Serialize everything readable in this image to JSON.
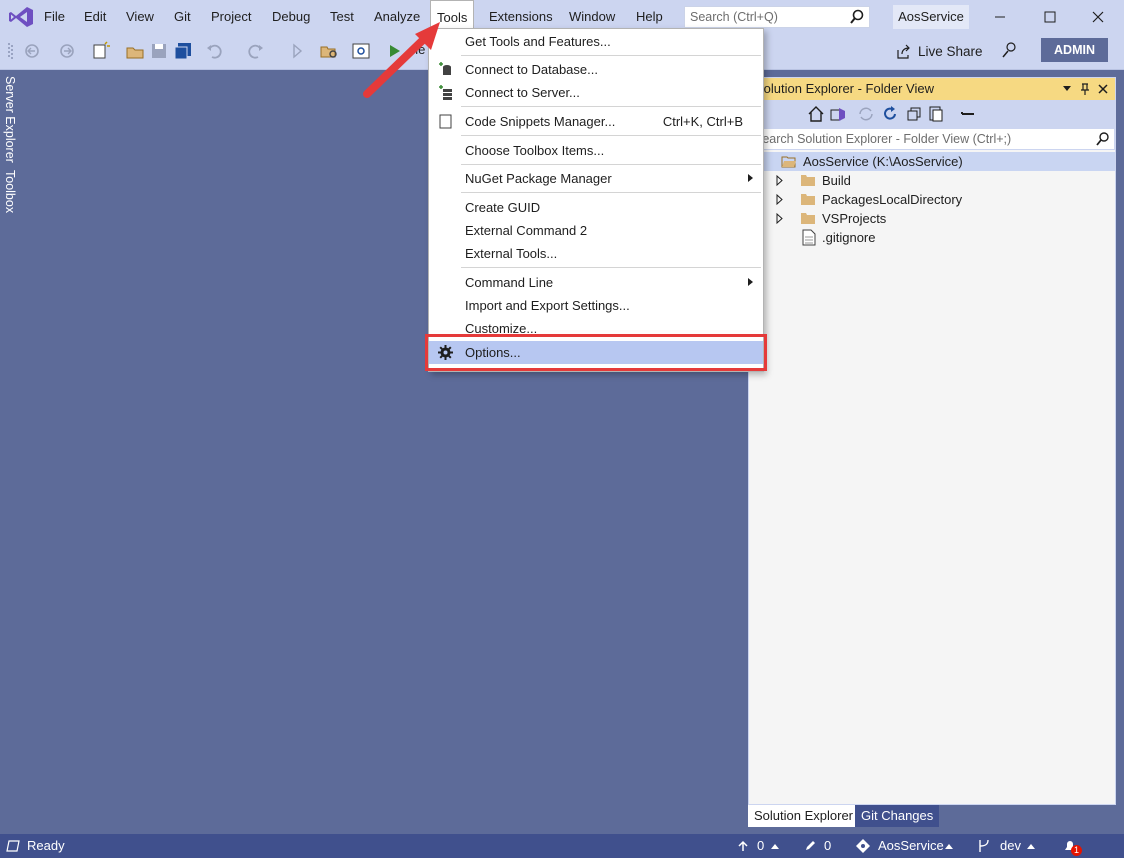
{
  "menubar": {
    "items": [
      "File",
      "Edit",
      "View",
      "Git",
      "Project",
      "Debug",
      "Test",
      "Analyze",
      "Tools",
      "Extensions",
      "Window",
      "Help"
    ],
    "search_placeholder": "Search (Ctrl+Q)",
    "project_name": "AosService"
  },
  "toolbar": {
    "live_share_label": "Live Share",
    "admin_label": "ADMIN",
    "start_label_partial": "ele"
  },
  "sidebar": {
    "tabs": [
      "Server Explorer",
      "Toolbox"
    ]
  },
  "tools_menu": {
    "items": [
      {
        "label": "Get Tools and Features...",
        "icon": ""
      },
      {
        "label": "Connect to Database...",
        "icon": "database-connect-icon"
      },
      {
        "label": "Connect to Server...",
        "icon": "server-connect-icon"
      },
      {
        "label": "Code Snippets Manager...",
        "shortcut": "Ctrl+K, Ctrl+B",
        "icon": "checkbox-icon"
      },
      {
        "label": "Choose Toolbox Items...",
        "icon": ""
      },
      {
        "label": "NuGet Package Manager",
        "submenu": true
      },
      {
        "label": "Create GUID"
      },
      {
        "label": "External Command 2"
      },
      {
        "label": "External Tools..."
      },
      {
        "label": "Command Line",
        "submenu": true
      },
      {
        "label": "Import and Export Settings..."
      },
      {
        "label": "Customize..."
      },
      {
        "label": "Options...",
        "icon": "gear-icon",
        "highlighted": true
      }
    ]
  },
  "solution_explorer": {
    "title": "Solution Explorer - Folder View",
    "search_placeholder": "Search Solution Explorer - Folder View (Ctrl+;)",
    "root": "AosService (K:\\AosService)",
    "children": [
      "Build",
      "PackagesLocalDirectory",
      "VSProjects",
      ".gitignore"
    ],
    "bottom_tabs": [
      "Solution Explorer",
      "Git Changes"
    ]
  },
  "statusbar": {
    "status": "Ready",
    "push_count": "0",
    "edit_count": "0",
    "repo": "AosService",
    "branch": "dev",
    "notifications": "1"
  },
  "colors": {
    "accent": "#5d6b99",
    "chrome": "#ccd5f0",
    "statusbar": "#40508d",
    "highlight_box": "#e53a3a"
  }
}
